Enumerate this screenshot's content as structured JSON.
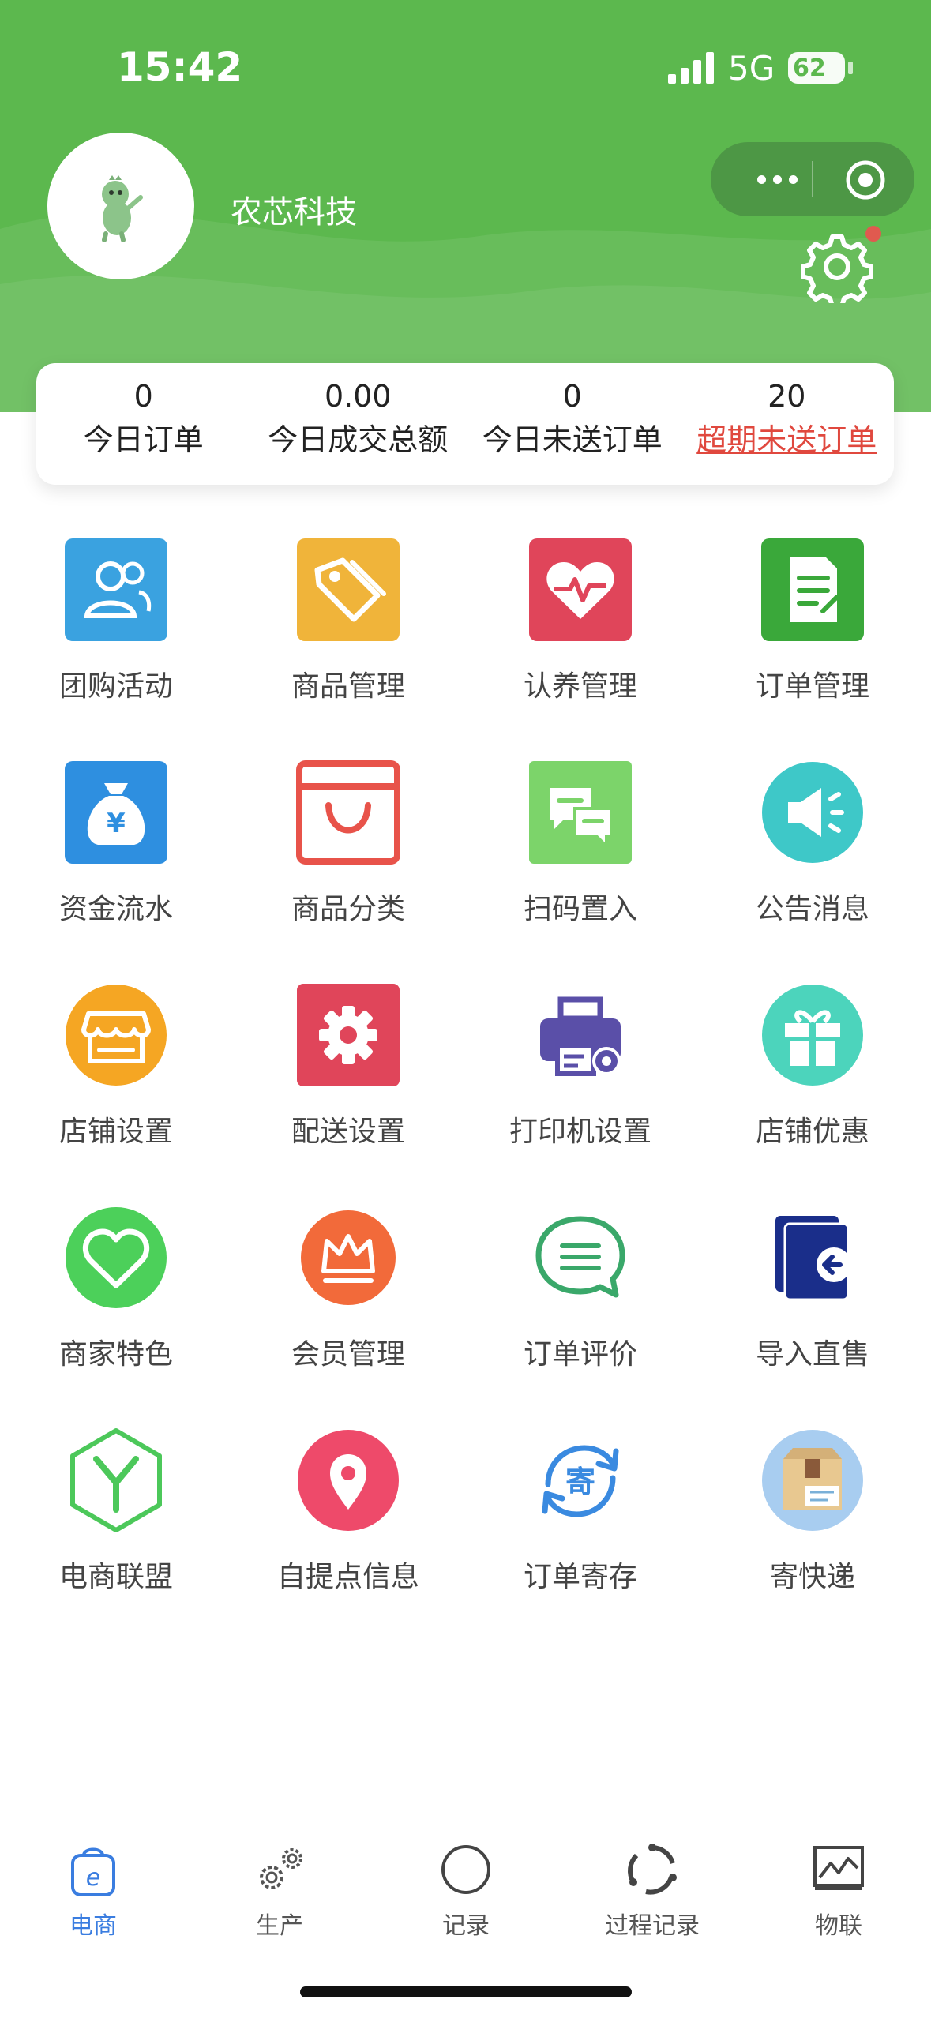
{
  "status_bar": {
    "time": "15:42",
    "network": "5G",
    "battery": "62"
  },
  "header": {
    "store_name": "农芯科技",
    "accent_color": "#5cb84e",
    "has_notification": true
  },
  "stats": [
    {
      "value": "0",
      "label": "今日订单"
    },
    {
      "value": "0.00",
      "label": "今日成交总额"
    },
    {
      "value": "0",
      "label": "今日未送订单"
    },
    {
      "value": "20",
      "label": "超期未送订单"
    }
  ],
  "grid": [
    {
      "label": "团购活动",
      "icon": "group-icon",
      "color": "#3aa2e0"
    },
    {
      "label": "商品管理",
      "icon": "tag-icon",
      "color": "#f0b43a"
    },
    {
      "label": "认养管理",
      "icon": "heart-pulse-icon",
      "color": "#e0455a"
    },
    {
      "label": "订单管理",
      "icon": "document-icon",
      "color": "#3aa83a"
    },
    {
      "label": "资金流水",
      "icon": "money-bag-icon",
      "color": "#2e8fe0"
    },
    {
      "label": "商品分类",
      "icon": "shopping-bag-icon",
      "color": "#e8534a"
    },
    {
      "label": "扫码置入",
      "icon": "scan-import-icon",
      "color": "#7cd46a"
    },
    {
      "label": "公告消息",
      "icon": "megaphone-icon",
      "color": "#3ec8c8"
    },
    {
      "label": "店铺设置",
      "icon": "storefront-icon",
      "color": "#f5a623"
    },
    {
      "label": "配送设置",
      "icon": "gear-icon",
      "color": "#e0455a"
    },
    {
      "label": "打印机设置",
      "icon": "printer-icon",
      "color": "#5a4fa8"
    },
    {
      "label": "店铺优惠",
      "icon": "gift-icon",
      "color": "#4cd4bc"
    },
    {
      "label": "商家特色",
      "icon": "heart-icon",
      "color": "#4cd05a"
    },
    {
      "label": "会员管理",
      "icon": "crown-icon",
      "color": "#f26a3a"
    },
    {
      "label": "订单评价",
      "icon": "chat-bubble-icon",
      "color": "#3aa86a"
    },
    {
      "label": "导入直售",
      "icon": "import-icon",
      "color": "#1a2e8a"
    },
    {
      "label": "电商联盟",
      "icon": "hexagon-y-icon",
      "color": "#4cc85a"
    },
    {
      "label": "自提点信息",
      "icon": "location-pin-icon",
      "color": "#ee4a6a"
    },
    {
      "label": "订单寄存",
      "icon": "deposit-cycle-icon",
      "color": "#3a8ae0"
    },
    {
      "label": "寄快递",
      "icon": "parcel-box-icon",
      "color": "#8ab8e8"
    }
  ],
  "tabbar": [
    {
      "label": "电商",
      "icon": "shopping-bag-e-icon",
      "active": true
    },
    {
      "label": "生产",
      "icon": "gears-icon",
      "active": false
    },
    {
      "label": "记录",
      "icon": "circle-icon",
      "active": false
    },
    {
      "label": "过程记录",
      "icon": "process-cycle-icon",
      "active": false
    },
    {
      "label": "物联",
      "icon": "monitor-chart-icon",
      "active": false
    }
  ]
}
